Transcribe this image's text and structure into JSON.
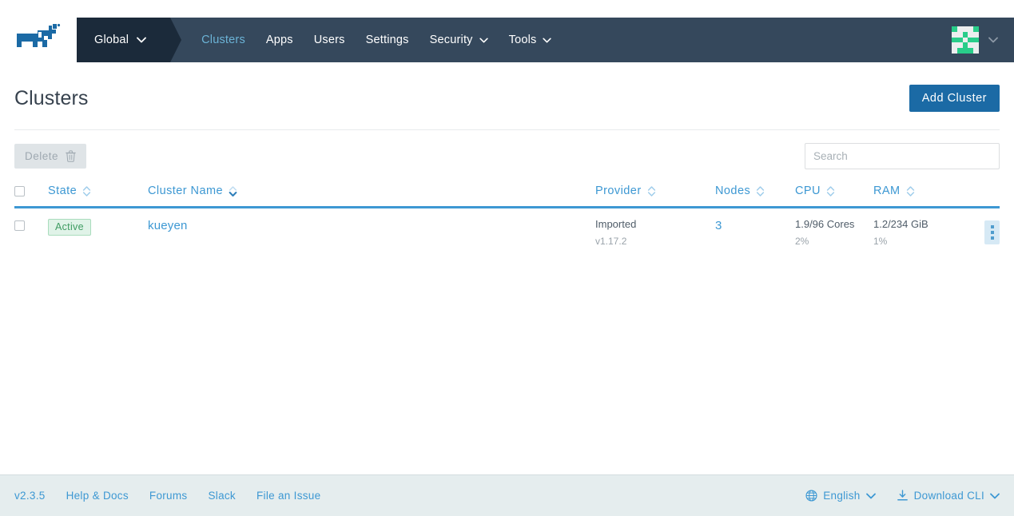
{
  "header": {
    "logo_icon": "rancher-cow-logo",
    "scope": {
      "label": "Global",
      "caret_icon": "chevron-down-icon"
    },
    "nav_items": [
      {
        "label": "Clusters",
        "active": true,
        "caret": false
      },
      {
        "label": "Apps",
        "active": false,
        "caret": false
      },
      {
        "label": "Users",
        "active": false,
        "caret": false
      },
      {
        "label": "Settings",
        "active": false,
        "caret": false
      },
      {
        "label": "Security",
        "active": false,
        "caret": true
      },
      {
        "label": "Tools",
        "active": false,
        "caret": true
      }
    ],
    "avatar_icon": "user-identicon-avatar",
    "avatar_caret_icon": "chevron-down-icon"
  },
  "page": {
    "title": "Clusters",
    "add_button_label": "Add Cluster"
  },
  "toolbar": {
    "delete_label": "Delete",
    "delete_icon": "trash-icon",
    "search_placeholder": "Search",
    "search_value": ""
  },
  "table": {
    "select_all_checked": false,
    "columns": [
      {
        "label": "State",
        "sortable": true,
        "sorted": "none"
      },
      {
        "label": "Cluster Name",
        "sortable": true,
        "sorted": "asc"
      },
      {
        "label": "Provider",
        "sortable": true,
        "sorted": "none"
      },
      {
        "label": "Nodes",
        "sortable": true,
        "sorted": "none"
      },
      {
        "label": "CPU",
        "sortable": true,
        "sorted": "none"
      },
      {
        "label": "RAM",
        "sortable": true,
        "sorted": "none"
      }
    ],
    "rows": [
      {
        "checked": false,
        "state": "Active",
        "name": "kueyen",
        "provider": "Imported",
        "provider_version": "v1.17.2",
        "nodes": "3",
        "cpu": "1.9/96 Cores",
        "cpu_percent": "2%",
        "ram": "1.2/234 GiB",
        "ram_percent": "1%",
        "actions_icon": "vertical-dots-icon"
      }
    ]
  },
  "footer": {
    "links": [
      {
        "label": "v2.3.5"
      },
      {
        "label": "Help & Docs"
      },
      {
        "label": "Forums"
      },
      {
        "label": "Slack"
      },
      {
        "label": "File an Issue"
      }
    ],
    "language": {
      "label": "English",
      "icon": "globe-icon",
      "caret_icon": "chevron-down-icon"
    },
    "download": {
      "label": "Download CLI",
      "icon": "download-icon",
      "caret_icon": "chevron-down-icon"
    }
  },
  "colors": {
    "nav_bg": "#35485c",
    "scope_bg": "#1b2a3a",
    "accent_blue": "#3d98d3",
    "primary_button": "#1b6aa5",
    "active_nav": "#6bb3d6",
    "badge_green_text": "#3f9c62",
    "badge_green_bg": "#e0f3e8",
    "avatar_green": "#29cd8a",
    "footer_bg": "#e5edee"
  }
}
